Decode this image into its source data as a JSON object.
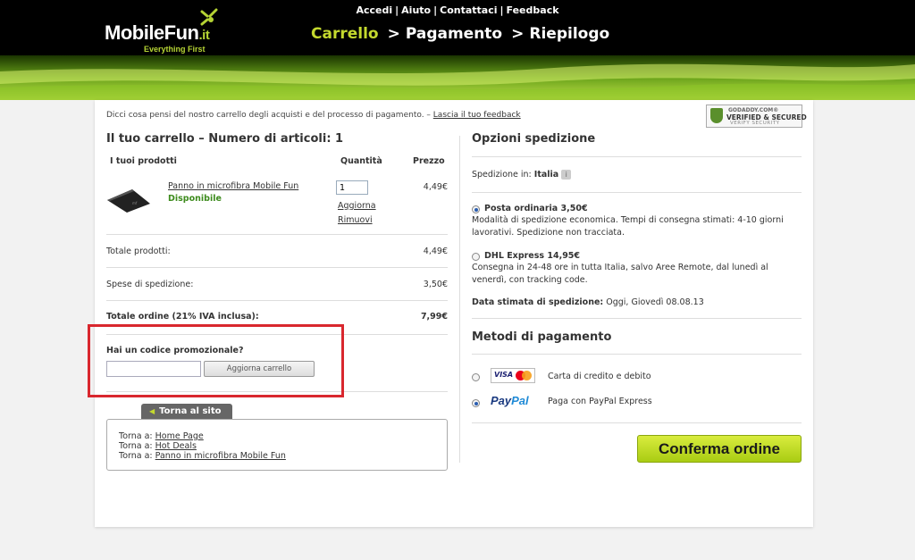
{
  "header": {
    "top_links": [
      "Accedi",
      "Aiuto",
      "Contattaci",
      "Feedback"
    ],
    "logo_text": "MobileFun",
    "logo_suffix": ".it",
    "logo_tagline": "Everything First",
    "steps": [
      "Carrello",
      "Pagamento",
      "Riepilogo"
    ],
    "step_separator": ">"
  },
  "feedback": {
    "text": "Dicci cosa pensi del nostro carrello degli acquisti e del processo di pagamento. –",
    "link": "Lascia il tuo feedback"
  },
  "badge": {
    "line1": "GODADDY.COM®",
    "line2": "VERIFIED & SECURED",
    "line3": "VERIFY SECURITY"
  },
  "cart": {
    "title": "Il tuo carrello – Numero di articoli: 1",
    "col_products": "I tuoi prodotti",
    "col_quantity": "Quantità",
    "col_price": "Prezzo",
    "item": {
      "name": "Panno in microfibra Mobile Fun",
      "availability": "Disponibile",
      "quantity": "1",
      "update": "Aggiorna",
      "remove": "Rimuovi",
      "price": "4,49€"
    },
    "totals": [
      {
        "label": "Totale prodotti:",
        "value": "4,49€"
      },
      {
        "label": "Spese di spedizione:",
        "value": "3,50€"
      },
      {
        "label": "Totale ordine (21% IVA inclusa):",
        "value": "7,99€"
      }
    ]
  },
  "promo": {
    "title": "Hai un codice promozionale?",
    "input_value": "",
    "button": "Aggiorna carrello"
  },
  "back": {
    "tab": "Torna al sito",
    "prefix": "Torna a:",
    "links": [
      "Home Page",
      "Hot Deals",
      "Panno in microfibra Mobile Fun"
    ]
  },
  "shipping": {
    "title": "Opzioni spedizione",
    "destination_label": "Spedizione in:",
    "destination": "Italia",
    "options": [
      {
        "name": "Posta ordinaria 3,50€",
        "desc": "Modalità di spedizione economica. Tempi di consegna stimati: 4-10 giorni lavorativi. Spedizione non tracciata.",
        "selected": true
      },
      {
        "name": "DHL Express 14,95€",
        "desc": "Consegna in 24-48 ore in tutta Italia, salvo Aree Remote, dal lunedì al venerdì, con tracking code.",
        "selected": false
      }
    ],
    "estimate_label": "Data stimata di spedizione:",
    "estimate": "Oggi, Giovedì 08.08.13"
  },
  "payment": {
    "title": "Metodi di pagamento",
    "methods": [
      {
        "logo": "VISA",
        "label": "Carta di credito e debito",
        "selected": false
      },
      {
        "logo": "PayPal",
        "label": "Paga con PayPal Express",
        "selected": true
      }
    ]
  },
  "confirm_button": "Conferma ordine",
  "colors": {
    "accent_green": "#c4d92e",
    "button_green": "#b5d82a",
    "available_green": "#3d8b1d",
    "highlight_red": "#d9272e"
  }
}
